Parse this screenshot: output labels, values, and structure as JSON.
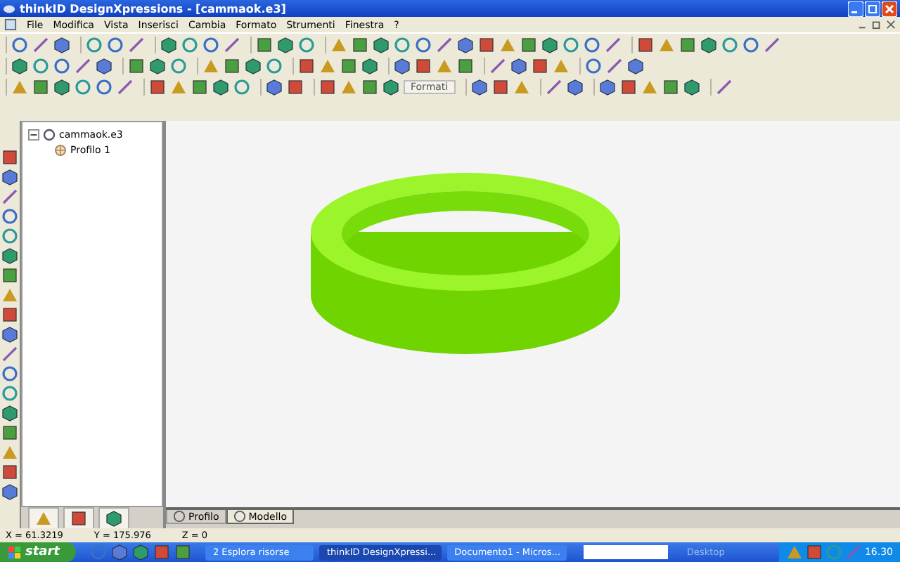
{
  "window": {
    "title": "thinkID DesignXpressions - [cammaok.e3]"
  },
  "menu": [
    "File",
    "Modifica",
    "Vista",
    "Inserisci",
    "Cambia",
    "Formato",
    "Strumenti",
    "Finestra",
    "?"
  ],
  "toolbar_dropdown": {
    "label": "Formati"
  },
  "tree": [
    {
      "label": "cammaok.e3",
      "expanded": true,
      "children": [
        {
          "label": "Profilo 1"
        }
      ]
    }
  ],
  "view_tabs": [
    {
      "label": "Profilo",
      "selected": false
    },
    {
      "label": "Modello",
      "selected": true
    }
  ],
  "status_bar": {
    "x": "X = 61.3219",
    "y": "Y = 175.976",
    "z": "Z = 0"
  },
  "taskbar": {
    "start": "start",
    "tasks": [
      {
        "label": "2 Esplora risorse",
        "selected": false
      },
      {
        "label": "thinkID DesignXpressi...",
        "selected": true
      },
      {
        "label": "Documento1 - Micros...",
        "selected": false
      }
    ],
    "desktop": "Desktop",
    "clock": "16.30"
  }
}
